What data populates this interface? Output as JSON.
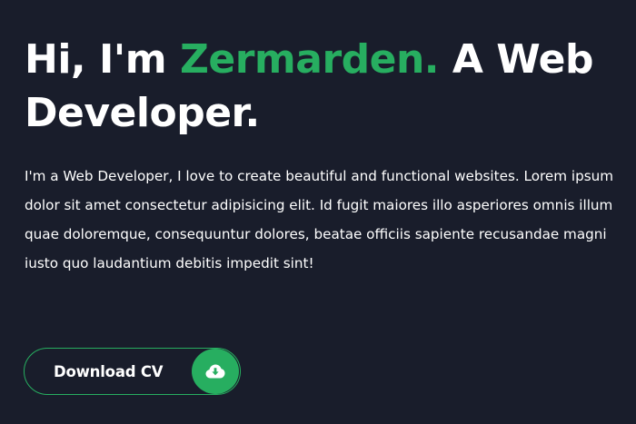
{
  "hero": {
    "title_prefix": "Hi, I'm ",
    "title_name": "Zermarden.",
    "title_suffix": " A Web Developer.",
    "description": "I'm a Web Developer, I love to create beautiful and functional websites. Lorem ipsum dolor sit amet consectetur adipisicing elit. Id fugit maiores illo asperiores omnis illum quae doloremque, consequuntur dolores, beatae officiis sapiente recusandae magni iusto quo laudantium debitis impedit sint!"
  },
  "cv_button": {
    "label": "Download CV",
    "icon": "cloud-download-icon"
  },
  "colors": {
    "background": "#191d2b",
    "accent": "#27ae60",
    "text": "#ffffff"
  }
}
